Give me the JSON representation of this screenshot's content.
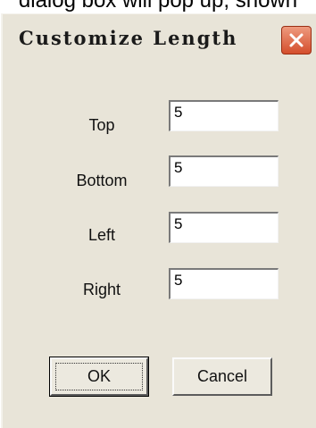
{
  "caption": "dialog box will pop up, shown",
  "dialog": {
    "title": "Customize Length",
    "fields": [
      {
        "label": "Top",
        "value": "5"
      },
      {
        "label": "Bottom",
        "value": "5"
      },
      {
        "label": "Left",
        "value": "5"
      },
      {
        "label": "Right",
        "value": "5"
      }
    ],
    "ok_label": "OK",
    "cancel_label": "Cancel",
    "close_icon": "close-icon",
    "close_color": "#d44e2c"
  }
}
